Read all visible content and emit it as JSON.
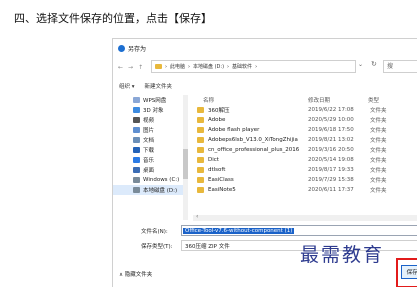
{
  "instruction": "四、选择文件保存的位置，点击【保存】",
  "dialog": {
    "title": "另存为",
    "nav": {
      "back": "←",
      "forward": "→",
      "up": "↑"
    },
    "path": [
      "此电脑",
      "本地磁盘 (D:)",
      "基础软件"
    ],
    "path_separator": "›",
    "search_placeholder": "搜",
    "refresh": "↻",
    "toolbar": {
      "organize": "组织 ▾",
      "new_folder": "新建文件夹"
    },
    "sidebar": [
      {
        "label": "WPS网盘",
        "icon": "cloud-icon",
        "color": "#8aa7d6"
      },
      {
        "label": "3D 对象",
        "icon": "cube-icon",
        "color": "#3d8be0"
      },
      {
        "label": "视频",
        "icon": "video-icon",
        "color": "#555"
      },
      {
        "label": "图片",
        "icon": "picture-icon",
        "color": "#5f8fd0"
      },
      {
        "label": "文档",
        "icon": "document-icon",
        "color": "#6b8fb8"
      },
      {
        "label": "下载",
        "icon": "download-icon",
        "color": "#2563b8"
      },
      {
        "label": "音乐",
        "icon": "music-icon",
        "color": "#2c7be5"
      },
      {
        "label": "桌面",
        "icon": "desktop-icon",
        "color": "#3b6db5"
      },
      {
        "label": "Windows (C:)",
        "icon": "drive-icon",
        "color": "#7a8b99"
      },
      {
        "label": "本地磁盘 (D:)",
        "icon": "drive-icon",
        "color": "#7a8b99",
        "selected": true
      }
    ],
    "columns": {
      "name": "名称",
      "date": "修改日期",
      "type": "类型"
    },
    "files": [
      {
        "name": "360解压",
        "date": "2019/6/22 17:08",
        "type": "文件夹"
      },
      {
        "name": "Adobe",
        "date": "2020/5/29 10:00",
        "type": "文件夹"
      },
      {
        "name": "Adobe flash player",
        "date": "2019/6/18 17:50",
        "type": "文件夹"
      },
      {
        "name": "Adobeps6lsb_V13.0_XiTongZhijia",
        "date": "2019/8/21 13:02",
        "type": "文件夹"
      },
      {
        "name": "cn_office_professional_plus_2016",
        "date": "2019/3/16 20:50",
        "type": "文件夹"
      },
      {
        "name": "Dict",
        "date": "2020/5/14 19:08",
        "type": "文件夹"
      },
      {
        "name": "dtlsoft",
        "date": "2019/8/17 19:33",
        "type": "文件夹"
      },
      {
        "name": "EasiClass",
        "date": "2019/7/29 15:38",
        "type": "文件夹"
      },
      {
        "name": "EasiNote5",
        "date": "2020/6/11 17:37",
        "type": "文件夹"
      }
    ],
    "filename_label": "文件名(N):",
    "filename_value": "Office-Tool-v7.6-without-component (1)",
    "filetype_label": "保存类型(T):",
    "filetype_value": "360压缩 ZIP 文件",
    "hide_folders": "∧ 隐藏文件夹",
    "save_button": "保存(S)"
  },
  "watermark": "最需教育",
  "colors": {
    "accent": "#1a62c9",
    "highlight": "#e21b1b",
    "folder": "#e8b83c"
  }
}
